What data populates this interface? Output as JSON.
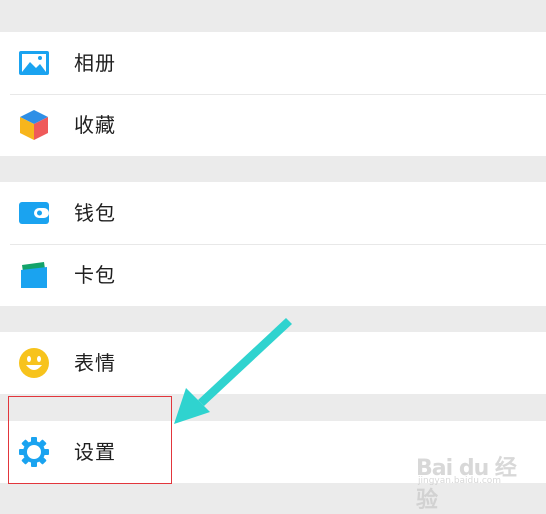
{
  "menu": {
    "album_label": "相册",
    "favorites_label": "收藏",
    "wallet_label": "钱包",
    "cards_label": "卡包",
    "stickers_label": "表情",
    "settings_label": "设置"
  },
  "watermark": {
    "main": "Bai du 经验",
    "sub": "jingyan.baidu.com"
  },
  "colors": {
    "background": "#ebebeb",
    "row": "#ffffff",
    "icon_blue": "#1aa3f0",
    "icon_green": "#1bc07a",
    "icon_yellow": "#f7c31c",
    "highlight": "#e2363c",
    "arrow": "#2fd3cf"
  }
}
